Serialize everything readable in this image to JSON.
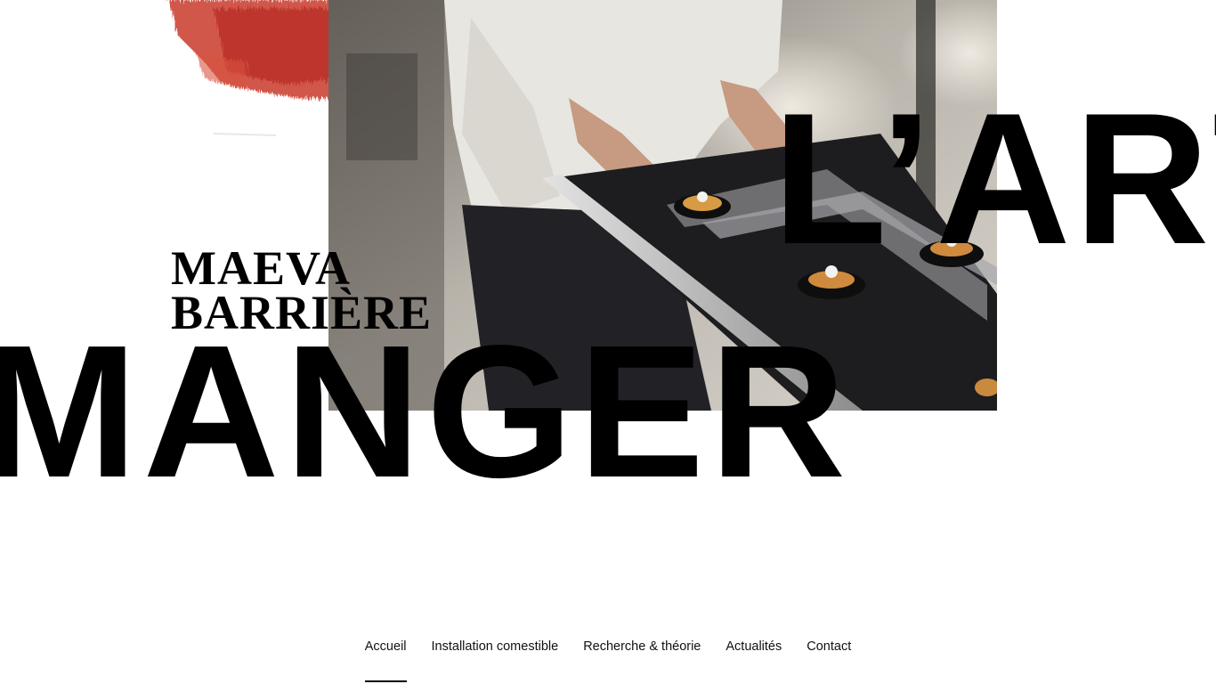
{
  "site": {
    "logo_line1": "MAEVA",
    "logo_line2": "BARRIÈRE"
  },
  "hero": {
    "word_top": "L’ART",
    "word_bottom": "MANGER",
    "accent_color": "#c9382b"
  },
  "nav": {
    "items": [
      {
        "label": "Accueil",
        "active": true
      },
      {
        "label": "Installation comestible",
        "active": false
      },
      {
        "label": "Recherche & théorie",
        "active": false
      },
      {
        "label": "Actualités",
        "active": false
      },
      {
        "label": "Contact",
        "active": false
      }
    ]
  }
}
